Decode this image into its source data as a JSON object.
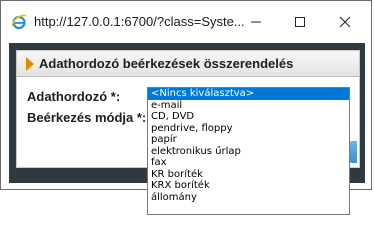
{
  "window": {
    "url_title": "http://127.0.0.1:6700/?class=Syste..."
  },
  "panel": {
    "title": "Adathordozó beérkezések összerendelés"
  },
  "form": {
    "media_label": "Adathordozó *:",
    "mode_label": "Beérkezés módja *:"
  },
  "dropdown": {
    "selected_index": 0,
    "options": [
      "<Nincs kiválasztva>",
      "e-mail",
      "CD, DVD",
      "pendrive, floppy",
      "papír",
      "elektronikus űrlap",
      "fax",
      "KR boríték",
      "KRX boríték",
      "állomány"
    ]
  },
  "colors": {
    "accent_arrow": "#e58a00",
    "selection": "#0078d7",
    "content_bg": "#2e3a40"
  },
  "icons": {
    "browser": "internet-explorer-icon",
    "minimize": "minimize-icon",
    "maximize": "maximize-icon",
    "close": "close-icon"
  }
}
